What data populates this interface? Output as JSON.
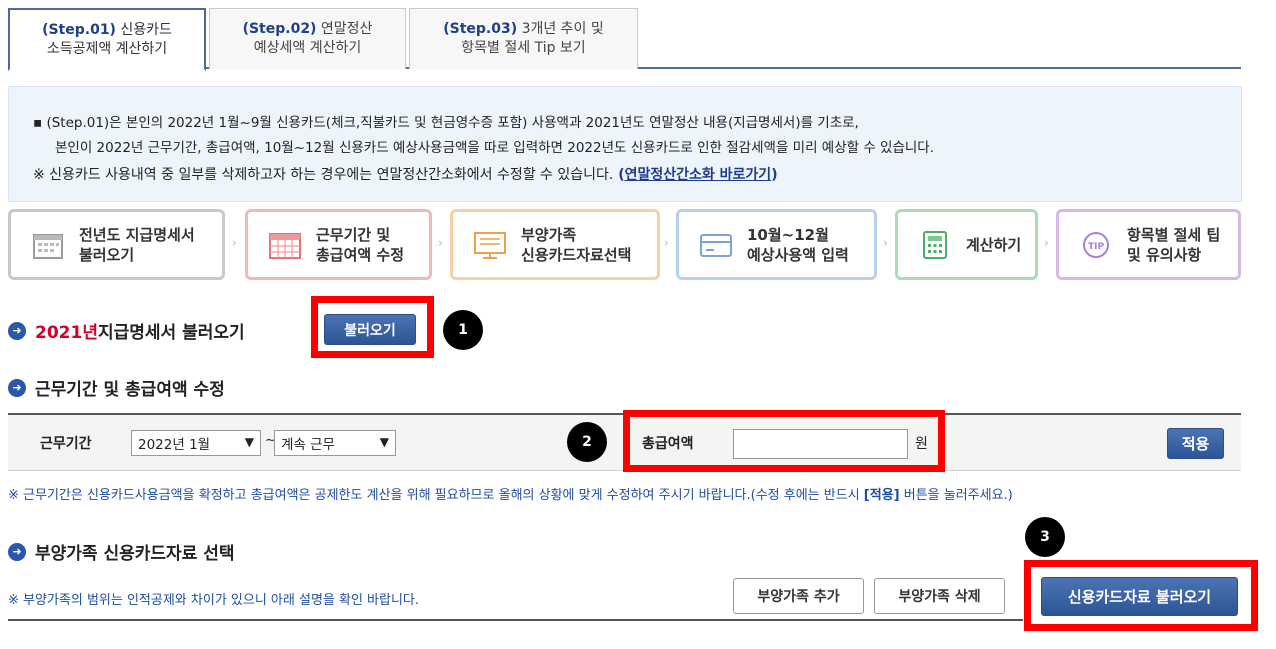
{
  "tabs": [
    {
      "step": "(Step.01)",
      "title1": "신용카드",
      "title2": "소득공제액 계산하기"
    },
    {
      "step": "(Step.02)",
      "title1": "연말정산",
      "title2": "예상세액 계산하기"
    },
    {
      "step": "(Step.03)",
      "title1": "3개년 추이 및",
      "title2": "항목별 절세 Tip 보기"
    }
  ],
  "info": {
    "line1": "▪ (Step.01)은 본인의 2022년 1월~9월 신용카드(체크,직불카드 및 현금영수증 포함) 사용액과 2021년도 연말정산 내용(지급명세서)를 기초로,",
    "line2": "본인이 2022년 근무기간, 총급여액, 10월~12월 신용카드 예상사용금액을 따로 입력하면 2022년도 신용카드로 인한 절감세액을 미리 예상할 수 있습니다.",
    "line3": "※ 신용카드 사용내역 중 일부를 삭제하고자 하는 경우에는 연말정산간소화에서 수정할 수 있습니다.",
    "link_open": " (",
    "link": "연말정산간소화 바로가기",
    "link_close": ")"
  },
  "steps": [
    {
      "l1": "전년도 지급명세서",
      "l2": "불러오기",
      "color": "#c8c8c8",
      "icon": "calendar-icon"
    },
    {
      "l1": "근무기간 및",
      "l2": "총급여액 수정",
      "color": "#f2b8b8",
      "icon": "calendar-grid-icon"
    },
    {
      "l1": "부양가족",
      "l2": "신용카드자료선택",
      "color": "#f6cfa4",
      "icon": "monitor-icon"
    },
    {
      "l1": "10월~12월",
      "l2": "예상사용액 입력",
      "color": "#b8cfee",
      "icon": "card-icon"
    },
    {
      "l1": "계산하기",
      "l2": "",
      "color": "#a9dcb4",
      "icon": "calculator-icon"
    },
    {
      "l1": "항목별 절세 팁",
      "l2": "및 유의사항",
      "color": "#d5b8e8",
      "icon": "tip-icon"
    }
  ],
  "sec1": {
    "year": "2021년",
    "title": " 지급명세서 불러오기",
    "button": "불러오기"
  },
  "sec2": {
    "title": "근무기간 및 총급여액 수정"
  },
  "work": {
    "period_label": "근무기간",
    "start": "2022년 1월",
    "tilde": "~",
    "end": "계속 근무",
    "salary_label": "총급여액",
    "salary_value": "",
    "unit": "원",
    "apply": "적용"
  },
  "note1": {
    "pre": "※ 근무기간은 신용카드사용금액을 확정하고 총급여액은 공제한도 계산을 위해 필요하므로 올해의 상황에 맞게 수정하여 주시기 바랍니다.(수정 후에는 반드시 ",
    "bold": "[적용]",
    "post": " 버튼을 눌러주세요.)"
  },
  "sec3": {
    "title": "부양가족 신용카드자료 선택"
  },
  "note2": "※ 부양가족의 범위는 인적공제와 차이가 있으니 아래 설명을 확인 바랍니다.",
  "buttons": {
    "add": "부양가족 추가",
    "delete": "부양가족 삭제",
    "load": "신용카드자료 불러오기"
  },
  "markers": [
    "1",
    "2",
    "3"
  ],
  "colors": {
    "accent": "#2c5596",
    "highlight": "#ff0000",
    "note": "#1e4ea0"
  }
}
